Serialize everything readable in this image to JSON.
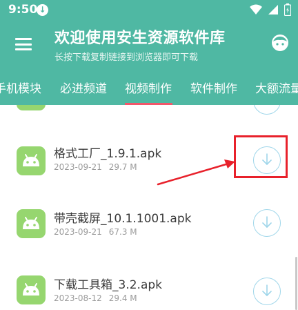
{
  "status_bar": {
    "time": "9:50"
  },
  "header": {
    "title": "欢迎使用安生资源软件库",
    "subtitle": "长按下载复制链接到浏览器即可下载"
  },
  "tabs": [
    {
      "label": "手机模块",
      "active": false
    },
    {
      "label": "必进频道",
      "active": false
    },
    {
      "label": "视频制作",
      "active": true
    },
    {
      "label": "软件制作",
      "active": false
    },
    {
      "label": "大额流量",
      "active": false
    }
  ],
  "files": [
    {
      "name": "格式工厂_1.9.1.apk",
      "date": "2023-09-21",
      "size": "29.7 M",
      "highlighted": true
    },
    {
      "name": "带壳截屏_10.1.1001.apk",
      "date": "2023-09-21",
      "size": "67.3 M",
      "highlighted": false
    },
    {
      "name": "下载工具箱_3.2.apk",
      "date": "2023-08-12",
      "size": "29.4 M",
      "highlighted": false
    }
  ],
  "colors": {
    "header": "#4fb8a3",
    "tab_indicator": "#f2566a",
    "apk_icon": "#96d66f",
    "download_ring": "#9fd6ea",
    "annotation": "#e8212b"
  },
  "icons": [
    "download-notification-icon",
    "wifi-icon",
    "signal-icon",
    "battery-icon",
    "menu-icon",
    "avatar-icon",
    "android-apk-icon",
    "download-icon"
  ]
}
